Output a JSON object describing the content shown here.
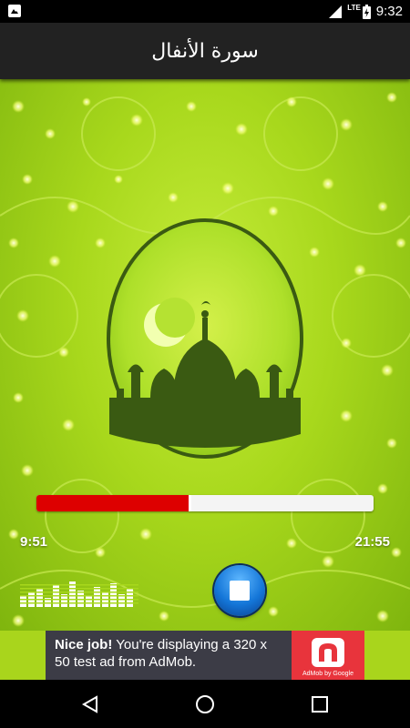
{
  "status_bar": {
    "network": "LTE",
    "time": "9:32",
    "battery_icon": "battery-charging-icon"
  },
  "app_bar": {
    "title": "سورة الأنفال"
  },
  "player": {
    "elapsed": "9:51",
    "total": "21:55",
    "progress_fraction": 0.45,
    "stop_icon": "stop-icon"
  },
  "ad": {
    "headline": "Nice job!",
    "body": "You're displaying a 320 x 50 test ad from AdMob.",
    "badge": "AdMob by Google"
  },
  "nav": {
    "back_icon": "back-icon",
    "home_icon": "home-icon",
    "recents_icon": "recents-icon"
  },
  "colors": {
    "accent_red": "#dd0000",
    "background_green": "#a8d81c",
    "mosque_green": "#3a5a12"
  }
}
